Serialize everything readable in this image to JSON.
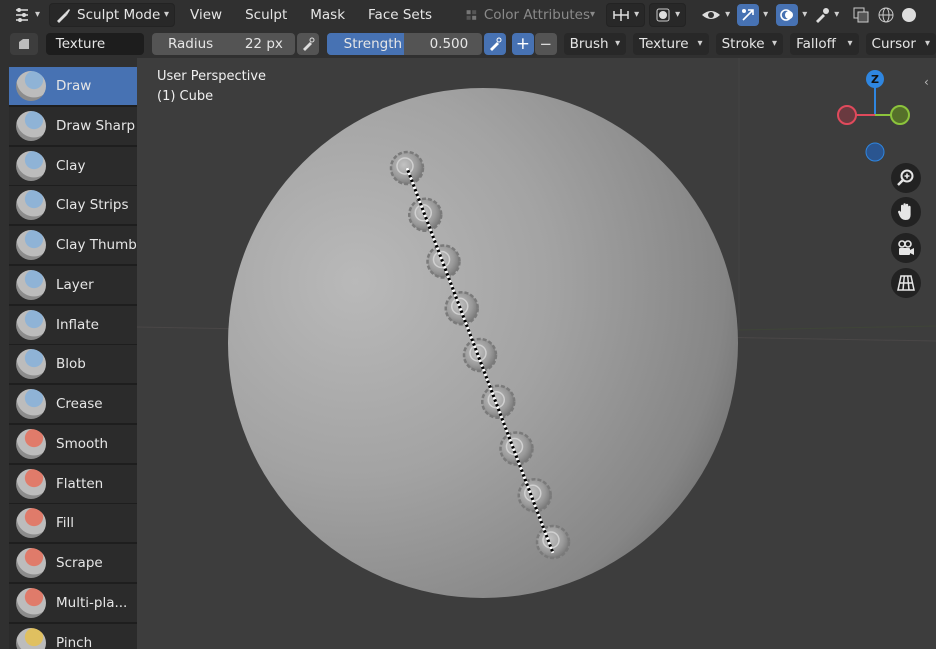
{
  "header": {
    "mode": "Sculpt Mode",
    "menus": [
      "View",
      "Sculpt",
      "Mask",
      "Face Sets"
    ],
    "color_attributes": "Color Attributes"
  },
  "toolbar": {
    "texture_label": "Texture",
    "radius_label": "Radius",
    "radius_value": "22 px",
    "strength_label": "Strength",
    "strength_value": "0.500",
    "plus": "+",
    "minus": "−",
    "dropdowns": [
      "Brush",
      "Texture",
      "Stroke",
      "Falloff",
      "Cursor"
    ]
  },
  "tools": [
    {
      "label": "Draw",
      "active": true,
      "color": "#8fb3d6"
    },
    {
      "label": "Draw Sharp",
      "active": false,
      "color": "#8fb3d6"
    },
    {
      "label": "Clay",
      "active": false,
      "color": "#8fb3d6"
    },
    {
      "label": "Clay Strips",
      "active": false,
      "color": "#8fb3d6"
    },
    {
      "label": "Clay Thumb",
      "active": false,
      "color": "#8fb3d6"
    },
    {
      "label": "Layer",
      "active": false,
      "color": "#8fb3d6"
    },
    {
      "label": "Inflate",
      "active": false,
      "color": "#8fb3d6"
    },
    {
      "label": "Blob",
      "active": false,
      "color": "#8fb3d6"
    },
    {
      "label": "Crease",
      "active": false,
      "color": "#8fb3d6"
    },
    {
      "label": "Smooth",
      "active": false,
      "color": "#e07b6a"
    },
    {
      "label": "Flatten",
      "active": false,
      "color": "#e07b6a"
    },
    {
      "label": "Fill",
      "active": false,
      "color": "#e07b6a"
    },
    {
      "label": "Scrape",
      "active": false,
      "color": "#e07b6a"
    },
    {
      "label": "Multi-pla...",
      "active": false,
      "color": "#e07b6a"
    },
    {
      "label": "Pinch",
      "active": false,
      "color": "#e0c060"
    }
  ],
  "viewport": {
    "perspective": "User Perspective",
    "object": "(1) Cube"
  },
  "gizmo": {
    "z_label": "Z",
    "x_color": "#e04a5c",
    "y_color": "#8cc43c",
    "z_color": "#2f86e0"
  },
  "colors": {
    "accent": "#4772b3",
    "background": "#303030"
  }
}
